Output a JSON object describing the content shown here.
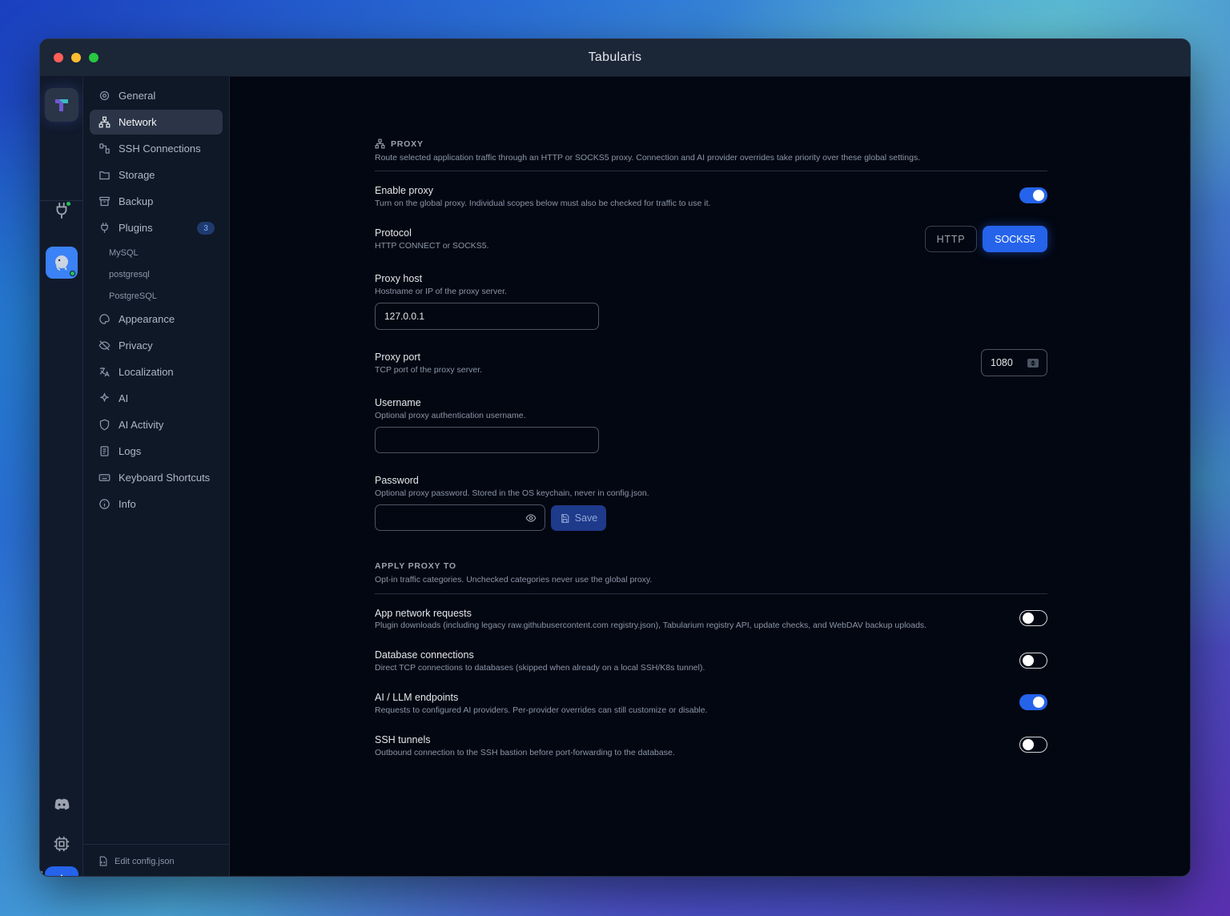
{
  "window": {
    "title": "Tabularis"
  },
  "sidebar": {
    "items": [
      {
        "label": "General",
        "icon": "gear-icon"
      },
      {
        "label": "Network",
        "icon": "network-icon",
        "active": true
      },
      {
        "label": "SSH Connections",
        "icon": "ssh-icon"
      },
      {
        "label": "Storage",
        "icon": "folder-icon"
      },
      {
        "label": "Backup",
        "icon": "archive-icon"
      },
      {
        "label": "Plugins",
        "icon": "plug-icon",
        "badge": "3"
      },
      {
        "label": "Appearance",
        "icon": "palette-icon"
      },
      {
        "label": "Privacy",
        "icon": "eye-off-icon"
      },
      {
        "label": "Localization",
        "icon": "translate-icon"
      },
      {
        "label": "AI",
        "icon": "sparkles-icon"
      },
      {
        "label": "AI Activity",
        "icon": "shield-icon"
      },
      {
        "label": "Logs",
        "icon": "scroll-icon"
      },
      {
        "label": "Keyboard Shortcuts",
        "icon": "keyboard-icon"
      },
      {
        "label": "Info",
        "icon": "info-icon"
      }
    ],
    "plugins": [
      "MySQL",
      "postgresql",
      "PostgreSQL"
    ],
    "footer": "Edit config.json"
  },
  "proxy": {
    "heading": "PROXY",
    "description": "Route selected application traffic through an HTTP or SOCKS5 proxy. Connection and AI provider overrides take priority over these global settings.",
    "enable": {
      "label": "Enable proxy",
      "desc": "Turn on the global proxy. Individual scopes below must also be checked for traffic to use it.",
      "on": true
    },
    "protocol": {
      "label": "Protocol",
      "desc": "HTTP CONNECT or SOCKS5.",
      "options": [
        "HTTP",
        "SOCKS5"
      ],
      "selected": "SOCKS5"
    },
    "host": {
      "label": "Proxy host",
      "desc": "Hostname or IP of the proxy server.",
      "value": "127.0.0.1"
    },
    "port": {
      "label": "Proxy port",
      "desc": "TCP port of the proxy server.",
      "value": "1080"
    },
    "username": {
      "label": "Username",
      "desc": "Optional proxy authentication username.",
      "value": ""
    },
    "password": {
      "label": "Password",
      "desc": "Optional proxy password. Stored in the OS keychain, never in config.json.",
      "value": "",
      "save_label": "Save"
    }
  },
  "apply": {
    "heading": "APPLY PROXY TO",
    "description": "Opt-in traffic categories. Unchecked categories never use the global proxy.",
    "items": [
      {
        "label": "App network requests",
        "desc": "Plugin downloads (including legacy raw.githubusercontent.com registry.json), Tabularium registry API, update checks, and WebDAV backup uploads.",
        "on": false
      },
      {
        "label": "Database connections",
        "desc": "Direct TCP connections to databases (skipped when already on a local SSH/K8s tunnel).",
        "on": false
      },
      {
        "label": "AI / LLM endpoints",
        "desc": "Requests to configured AI providers. Per-provider overrides can still customize or disable.",
        "on": true
      },
      {
        "label": "SSH tunnels",
        "desc": "Outbound connection to the SSH bastion before port-forwarding to the database.",
        "on": false
      }
    ]
  },
  "colors": {
    "accent": "#2563eb",
    "background": "#030712",
    "sidebar": "#0f1827"
  }
}
